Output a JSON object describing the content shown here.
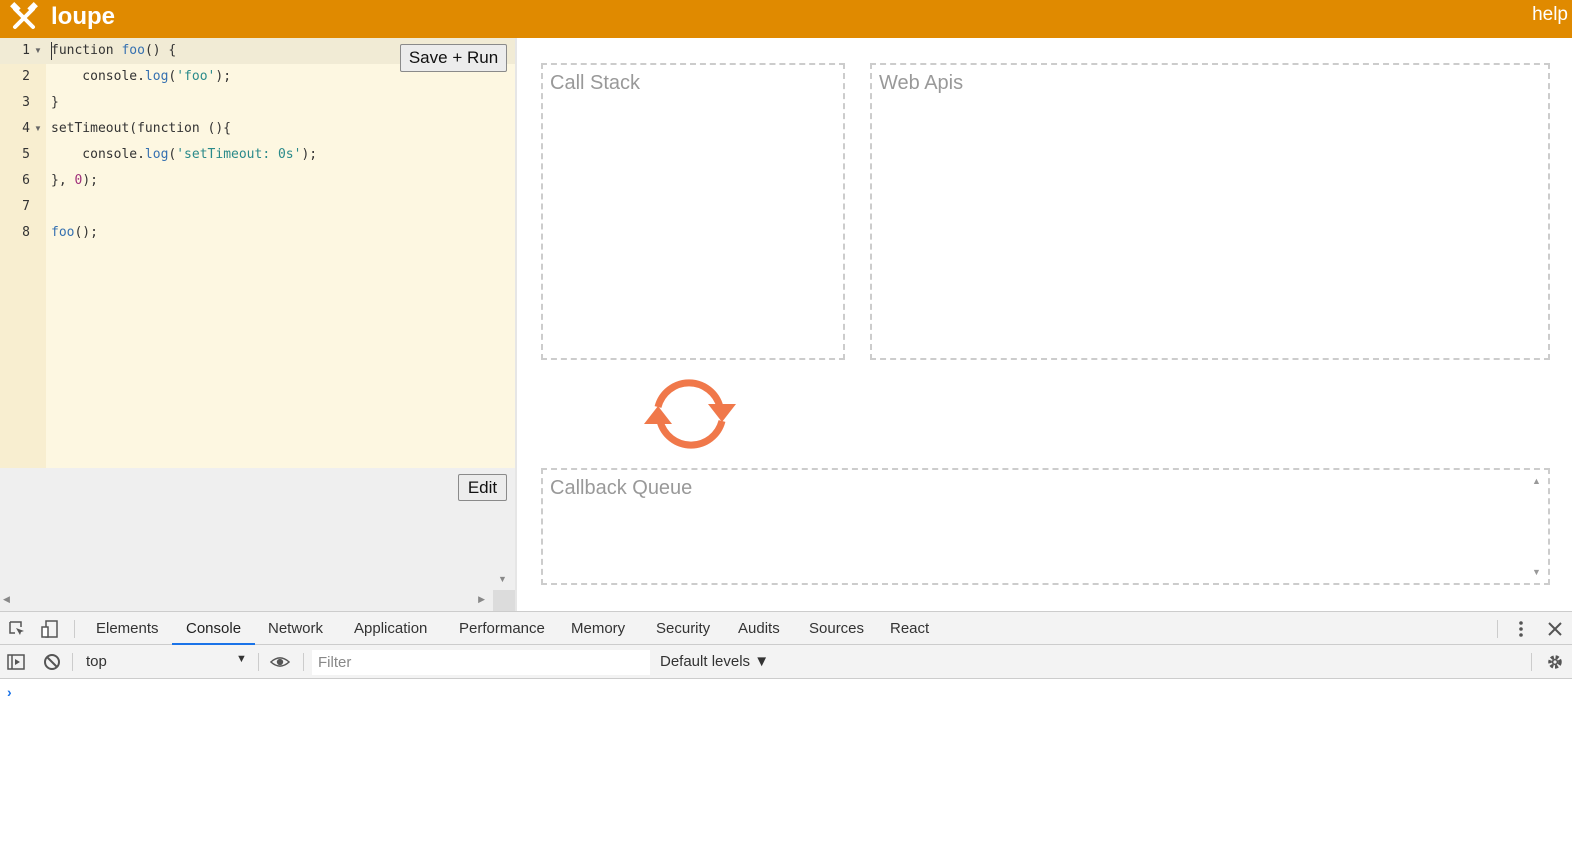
{
  "header": {
    "title": "loupe",
    "help": "help",
    "logo_icon": "tools-icon"
  },
  "editor": {
    "save_run_label": "Save + Run",
    "lines": [
      {
        "num": "1",
        "fold": true,
        "code": "function foo() {"
      },
      {
        "num": "2",
        "fold": false,
        "code": "    console.log('foo');"
      },
      {
        "num": "3",
        "fold": false,
        "code": "}"
      },
      {
        "num": "4",
        "fold": true,
        "code": "setTimeout(function (){"
      },
      {
        "num": "5",
        "fold": false,
        "code": "    console.log('setTimeout: 0s');"
      },
      {
        "num": "6",
        "fold": false,
        "code": "}, 0);"
      },
      {
        "num": "7",
        "fold": false,
        "code": ""
      },
      {
        "num": "8",
        "fold": false,
        "code": "foo();"
      }
    ]
  },
  "output": {
    "edit_label": "Edit"
  },
  "visualizer": {
    "call_stack_title": "Call Stack",
    "web_apis_title": "Web Apis",
    "callback_queue_title": "Callback Queue",
    "loop_icon": "refresh-icon",
    "loop_color": "#f0784a"
  },
  "devtools": {
    "tabs": [
      "Elements",
      "Console",
      "Network",
      "Application",
      "Performance",
      "Memory",
      "Security",
      "Audits",
      "Sources",
      "React"
    ],
    "active_tab": "Console",
    "context": "top",
    "filter_placeholder": "Filter",
    "levels_label": "Default levels ▼",
    "prompt": "›"
  },
  "colors": {
    "header": "#e08a00",
    "editor_bg": "#fdf7e1",
    "accent_blue": "#1a73e8"
  }
}
